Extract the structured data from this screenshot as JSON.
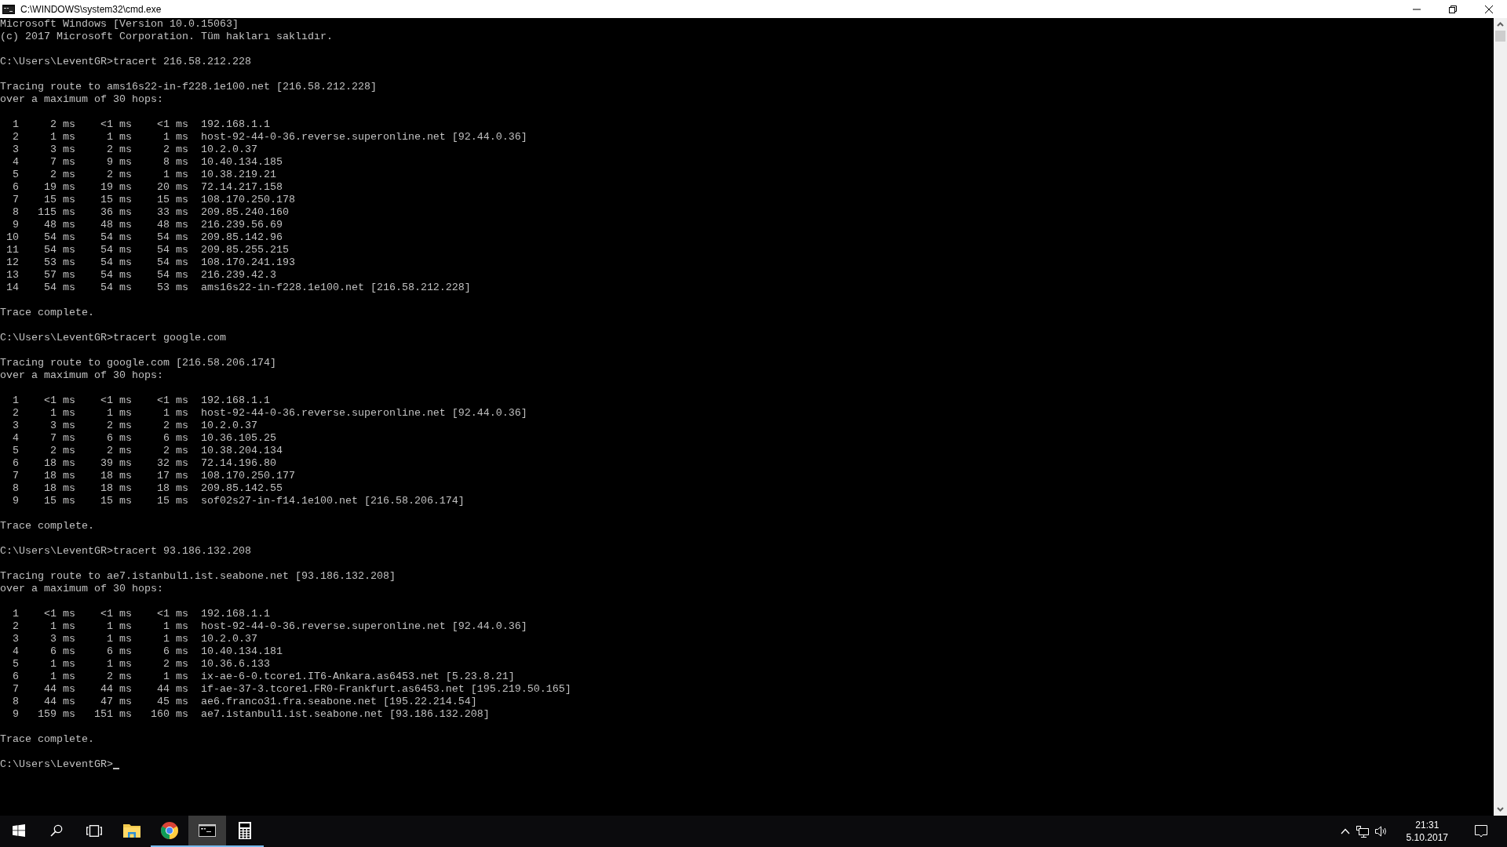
{
  "window": {
    "title": "C:\\WINDOWS\\system32\\cmd.exe"
  },
  "console": {
    "blocks": [
      [
        "Microsoft Windows [Version 10.0.15063]",
        "(c) 2017 Microsoft Corporation. Tüm hakları saklıdır."
      ],
      [
        "C:\\Users\\LeventGR>tracert 216.58.212.228"
      ],
      [
        "Tracing route to ams16s22-in-f228.1e100.net [216.58.212.228]",
        "over a maximum of 30 hops:"
      ],
      [
        "  1     2 ms    <1 ms    <1 ms  192.168.1.1",
        "  2     1 ms     1 ms     1 ms  host-92-44-0-36.reverse.superonline.net [92.44.0.36]",
        "  3     3 ms     2 ms     2 ms  10.2.0.37",
        "  4     7 ms     9 ms     8 ms  10.40.134.185",
        "  5     2 ms     2 ms     1 ms  10.38.219.21",
        "  6    19 ms    19 ms    20 ms  72.14.217.158",
        "  7    15 ms    15 ms    15 ms  108.170.250.178",
        "  8   115 ms    36 ms    33 ms  209.85.240.160",
        "  9    48 ms    48 ms    48 ms  216.239.56.69",
        " 10    54 ms    54 ms    54 ms  209.85.142.96",
        " 11    54 ms    54 ms    54 ms  209.85.255.215",
        " 12    53 ms    54 ms    54 ms  108.170.241.193",
        " 13    57 ms    54 ms    54 ms  216.239.42.3",
        " 14    54 ms    54 ms    53 ms  ams16s22-in-f228.1e100.net [216.58.212.228]"
      ],
      [
        "Trace complete."
      ],
      [
        "C:\\Users\\LeventGR>tracert google.com"
      ],
      [
        "Tracing route to google.com [216.58.206.174]",
        "over a maximum of 30 hops:"
      ],
      [
        "  1    <1 ms    <1 ms    <1 ms  192.168.1.1",
        "  2     1 ms     1 ms     1 ms  host-92-44-0-36.reverse.superonline.net [92.44.0.36]",
        "  3     3 ms     2 ms     2 ms  10.2.0.37",
        "  4     7 ms     6 ms     6 ms  10.36.105.25",
        "  5     2 ms     2 ms     2 ms  10.38.204.134",
        "  6    18 ms    39 ms    32 ms  72.14.196.80",
        "  7    18 ms    18 ms    17 ms  108.170.250.177",
        "  8    18 ms    18 ms    18 ms  209.85.142.55",
        "  9    15 ms    15 ms    15 ms  sof02s27-in-f14.1e100.net [216.58.206.174]"
      ],
      [
        "Trace complete."
      ],
      [
        "C:\\Users\\LeventGR>tracert 93.186.132.208"
      ],
      [
        "Tracing route to ae7.istanbul1.ist.seabone.net [93.186.132.208]",
        "over a maximum of 30 hops:"
      ],
      [
        "  1    <1 ms    <1 ms    <1 ms  192.168.1.1",
        "  2     1 ms     1 ms     1 ms  host-92-44-0-36.reverse.superonline.net [92.44.0.36]",
        "  3     3 ms     1 ms     1 ms  10.2.0.37",
        "  4     6 ms     6 ms     6 ms  10.40.134.181",
        "  5     1 ms     1 ms     2 ms  10.36.6.133",
        "  6     1 ms     2 ms     1 ms  ix-ae-6-0.tcore1.IT6-Ankara.as6453.net [5.23.8.21]",
        "  7    44 ms    44 ms    44 ms  if-ae-37-3.tcore1.FR0-Frankfurt.as6453.net [195.219.50.165]",
        "  8    44 ms    47 ms    45 ms  ae6.franco31.fra.seabone.net [195.22.214.54]",
        "  9   159 ms   151 ms   160 ms  ae7.istanbul1.ist.seabone.net [93.186.132.208]"
      ],
      [
        "Trace complete."
      ],
      [
        "C:\\Users\\LeventGR>"
      ]
    ],
    "cursor": true
  },
  "taskbar": {
    "apps": [
      {
        "kind": "start",
        "running": false,
        "selected": false
      },
      {
        "kind": "search",
        "running": false,
        "selected": false
      },
      {
        "kind": "taskview",
        "running": false,
        "selected": false
      },
      {
        "kind": "explorer",
        "running": false,
        "selected": false
      },
      {
        "kind": "chrome",
        "running": true,
        "selected": false
      },
      {
        "kind": "cmd",
        "running": true,
        "selected": true
      },
      {
        "kind": "calculator",
        "running": true,
        "selected": false
      }
    ],
    "clock": {
      "time": "21:31",
      "date": "5.10.2017"
    }
  }
}
